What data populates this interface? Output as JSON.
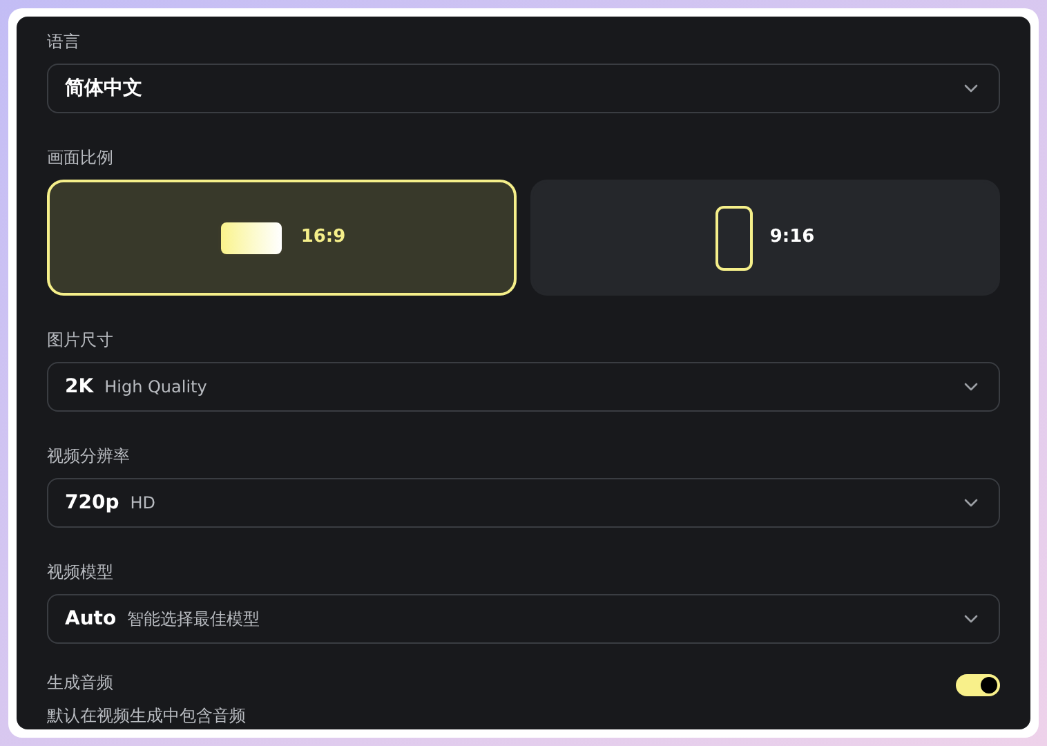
{
  "language": {
    "label": "语言",
    "value": "简体中文"
  },
  "aspect_ratio": {
    "label": "画面比例",
    "options": [
      {
        "label": "16:9",
        "kind": "landscape",
        "selected": true
      },
      {
        "label": "9:16",
        "kind": "portrait",
        "selected": false
      }
    ]
  },
  "selects": [
    {
      "label": "图片尺寸",
      "value": "2K",
      "hint": "High Quality"
    },
    {
      "label": "视频分辨率",
      "value": "720p",
      "hint": "HD"
    },
    {
      "label": "视频模型",
      "value": "Auto",
      "hint": "智能选择最佳模型"
    }
  ],
  "audio": {
    "label": "生成音频",
    "description": "默认在视频生成中包含音频",
    "on": true
  }
}
